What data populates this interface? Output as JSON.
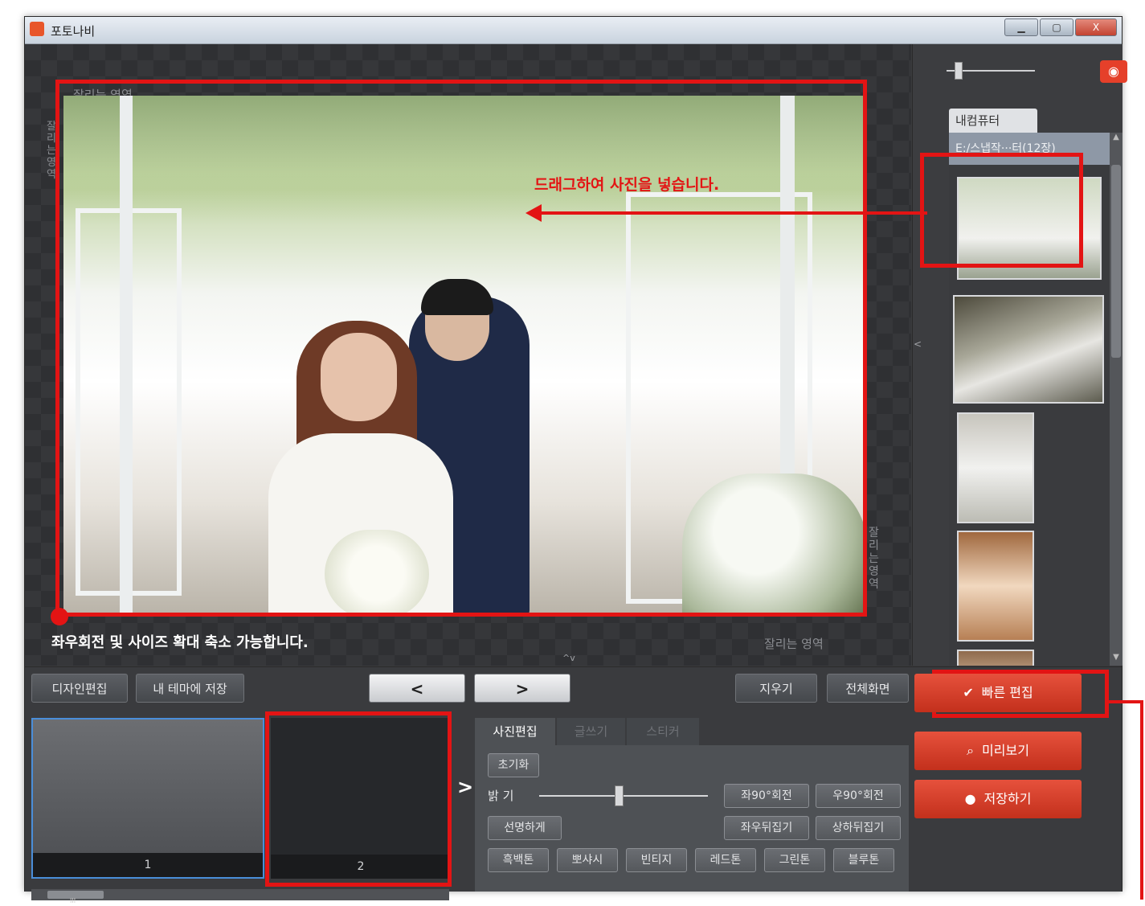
{
  "window": {
    "title": "포토나비",
    "min_label": "▁",
    "max_label": "▢",
    "close_label": "X"
  },
  "canvas": {
    "crop_label_top": "잘리는 영역",
    "crop_label_left": "잘리는영역",
    "crop_label_right": "잘리는영역",
    "crop_label_bottom": "잘리는 영역",
    "drag_hint": "드래그하여 사진을 넣습니다.",
    "rotate_hint": "좌우회전 및 사이즈 확대 축소 가능합니다.",
    "expand_caret": "^v"
  },
  "sidebar": {
    "camera_icon": "camera-icon",
    "tab_label": "내컴퓨터",
    "path_label": "E:/스냅작···터(12장)",
    "collapse_caret": "<"
  },
  "toolbar": {
    "design_edit": "디자인편집",
    "save_theme": "내 테마에 저장",
    "prev": "<",
    "next": ">",
    "erase": "지우기",
    "fullscreen": "전체화면"
  },
  "pages": [
    {
      "number": "1"
    },
    {
      "number": "2"
    }
  ],
  "pages_next": ">",
  "scroll_grip": "III",
  "edit_panel": {
    "tabs": [
      "사진편집",
      "글쓰기",
      "스티커"
    ],
    "reset": "초기화",
    "brightness_label": "밝 기",
    "brightness_value": 0.47,
    "rotate_left": "좌90°회전",
    "rotate_right": "우90°회전",
    "sharpen": "선명하게",
    "flip_h": "좌우뒤집기",
    "flip_v": "상하뒤집기",
    "filters": [
      "흑백톤",
      "뽀샤시",
      "빈티지",
      "레드톤",
      "그린톤",
      "블루톤"
    ]
  },
  "actions": {
    "quick_edit": "빠른 편집",
    "preview": "미리보기",
    "save": "저장하기"
  },
  "colors": {
    "accent": "#e5402a",
    "annotation": "#e31414",
    "selection": "#4a8ed9"
  }
}
